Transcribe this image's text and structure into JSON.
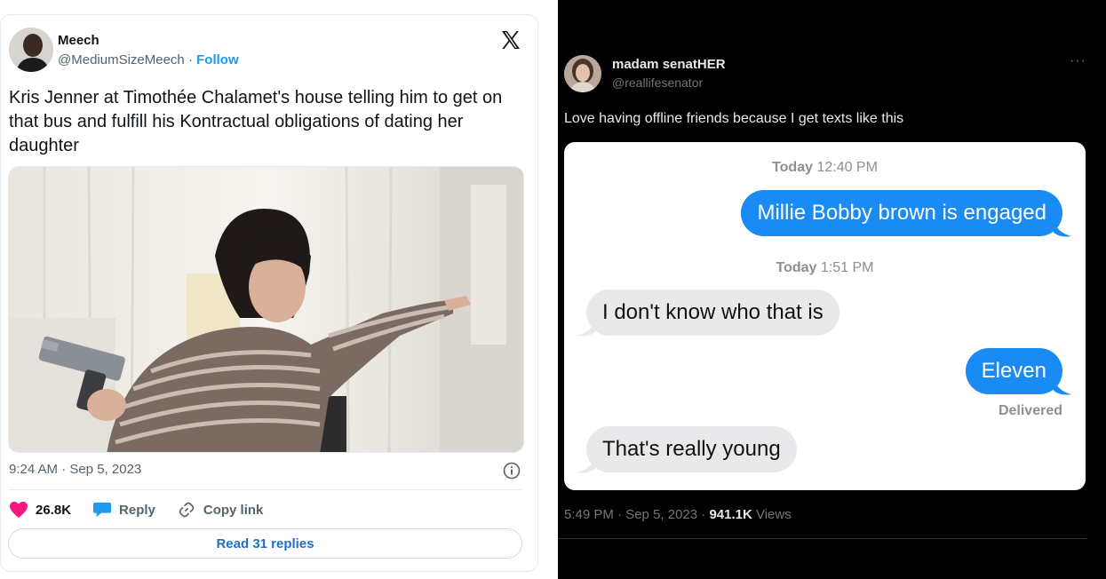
{
  "left_tweet": {
    "display_name": "Meech",
    "handle": "@MediumSizeMeech",
    "separator": " · ",
    "follow_label": "Follow",
    "text": "Kris Jenner at Timothée Chalamet's house telling him to get on that bus and fulfill his Kontractual obligations of dating her daughter",
    "timestamp": "9:24 AM · Sep 5, 2023",
    "likes_count": "26.8K",
    "reply_label": "Reply",
    "copy_link_label": "Copy link",
    "read_replies_label": "Read 31 replies",
    "icons": [
      "x-logo-icon",
      "info-icon",
      "heart-icon",
      "reply-bubble-icon",
      "link-icon"
    ],
    "colors": {
      "follow": "#1d9bf0",
      "heart": "#f91880",
      "reply_icon": "#1d9bf0"
    }
  },
  "right_tweet": {
    "display_name": "madam senatHER",
    "handle": "@reallifesenator",
    "more_label": "···",
    "text": "Love having offline friends because I get texts like this",
    "messages": {
      "timestamp_1_day": "Today",
      "timestamp_1_time": " 12:40 PM",
      "bubble_1": "Millie Bobby brown is engaged",
      "timestamp_2_day": "Today",
      "timestamp_2_time": " 1:51 PM",
      "bubble_2": "I don't know who that is",
      "bubble_3": "Eleven",
      "delivered": "Delivered",
      "bubble_4": "That's really young"
    },
    "meta_time": "5:49 PM · Sep 5, 2023 · ",
    "views_count": "941.1K",
    "views_label": " Views",
    "colors": {
      "outgoing_bubble": "#1a8bf5",
      "incoming_bubble": "#e9e9eb",
      "background": "#000000"
    }
  }
}
